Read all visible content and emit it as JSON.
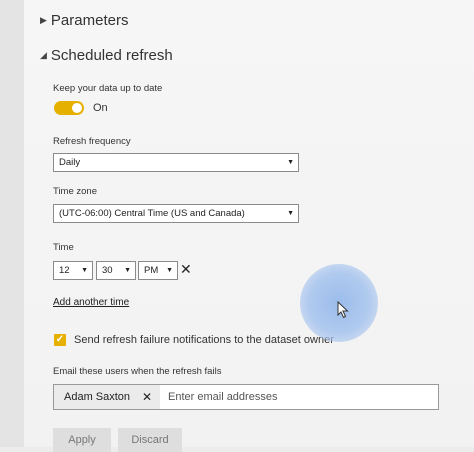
{
  "parameters": {
    "label": "Parameters",
    "icon": "collapsed-triangle-icon"
  },
  "scheduled_refresh": {
    "label": "Scheduled refresh",
    "icon": "expanded-triangle-icon",
    "keep_up_to_date_label": "Keep your data up to date",
    "toggle_state": "On",
    "toggle_color": "#e6b000",
    "frequency_label": "Refresh frequency",
    "frequency_value": "Daily",
    "timezone_label": "Time zone",
    "timezone_value": "(UTC-06:00) Central Time (US and Canada)",
    "time_label": "Time",
    "time": {
      "hour": "12",
      "minute": "30",
      "ampm": "PM"
    },
    "remove_time_icon": "close-icon",
    "add_time_link": "Add another time",
    "notify_checkbox_label": "Send refresh failure notifications to the dataset owner",
    "notify_checked": true,
    "email_label": "Email these users when the refresh fails",
    "email_chip": "Adam Saxton",
    "email_placeholder": "Enter email addresses",
    "apply_label": "Apply",
    "discard_label": "Discard"
  }
}
